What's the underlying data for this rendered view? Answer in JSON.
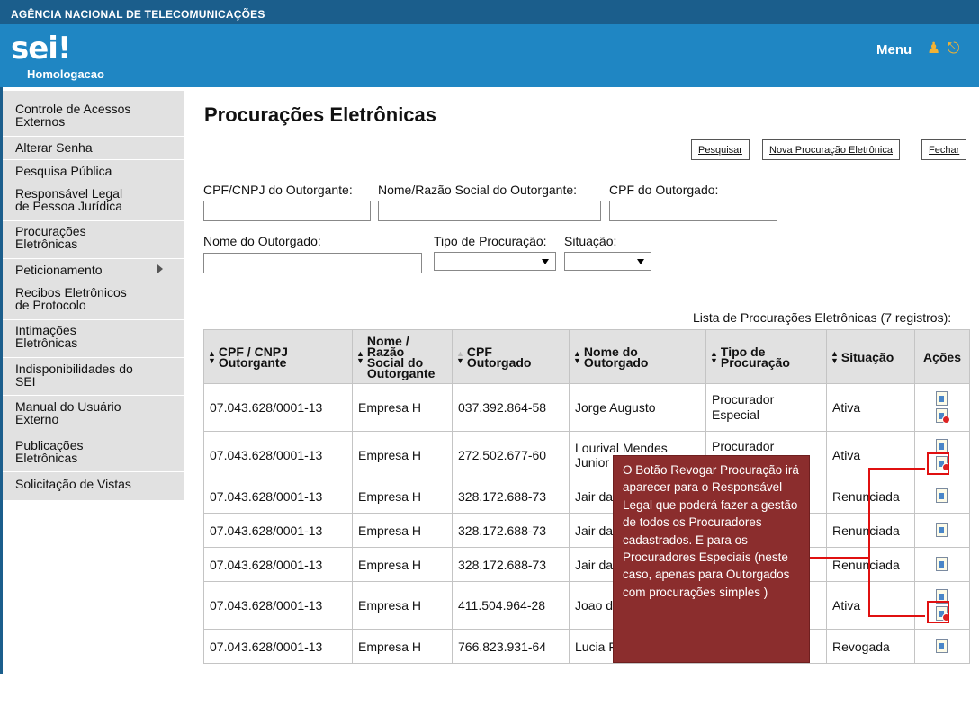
{
  "topbar": {
    "org": "AGÊNCIA NACIONAL DE TELECOMUNICAÇÕES"
  },
  "header": {
    "logo": "sei!",
    "environment": "Homologacao",
    "menu_label": "Menu"
  },
  "sidebar": {
    "items": [
      {
        "label": "Controle de Acessos\nExternos"
      },
      {
        "label": "Alterar Senha"
      },
      {
        "label": "Pesquisa Pública"
      },
      {
        "label": "Responsável Legal\nde Pessoa Jurídica"
      },
      {
        "label": "Procurações\nEletrônicas"
      },
      {
        "label": "Peticionamento"
      },
      {
        "label": "Recibos Eletrônicos\nde Protocolo"
      },
      {
        "label": "Intimações\nEletrônicas"
      },
      {
        "label": "Indisponibilidades do\nSEI"
      },
      {
        "label": "Manual do Usuário\nExterno"
      },
      {
        "label": "Publicações\nEletrônicas"
      },
      {
        "label": "Solicitação de Vistas"
      }
    ]
  },
  "page": {
    "title": "Procurações Eletrônicas",
    "buttons": {
      "search": "Pesquisar",
      "new": "Nova Procuração Eletrônica",
      "close": "Fechar"
    }
  },
  "filters": {
    "cpf_outorgante_label": "CPF/CNPJ do Outorgante:",
    "nome_outorgante_label": "Nome/Razão Social do Outorgante:",
    "cpf_outorgado_label": "CPF do Outorgado:",
    "nome_outorgado_label": "Nome do Outorgado:",
    "tipo_label": "Tipo de Procuração:",
    "situacao_label": "Situação:"
  },
  "table": {
    "caption": "Lista de Procurações Eletrônicas (7 registros):",
    "columns": {
      "c1": "CPF / CNPJ\nOutorgante",
      "c2": "Nome /\nRazão\nSocial do\nOutorgante",
      "c3": "CPF\nOutorgado",
      "c4": "Nome do\nOutorgado",
      "c5": "Tipo de\nProcuração",
      "c6": "Situação",
      "c7": "Ações"
    },
    "rows": [
      {
        "cpf_cnpj": "07.043.628/0001-13",
        "razao": "Empresa H",
        "cpf": "037.392.864-58",
        "nome": "Jorge Augusto",
        "tipo": "Procurador\nEspecial",
        "situacao": "Ativa",
        "revoke": true
      },
      {
        "cpf_cnpj": "07.043.628/0001-13",
        "razao": "Empresa H",
        "cpf": "272.502.677-60",
        "nome": "Lourival Mendes\nJunior",
        "tipo": "Procurador",
        "situacao": "Ativa",
        "revoke": true
      },
      {
        "cpf_cnpj": "07.043.628/0001-13",
        "razao": "Empresa H",
        "cpf": "328.172.688-73",
        "nome": "Jair da",
        "tipo": "",
        "situacao": "Renunciada",
        "revoke": false
      },
      {
        "cpf_cnpj": "07.043.628/0001-13",
        "razao": "Empresa H",
        "cpf": "328.172.688-73",
        "nome": "Jair da",
        "tipo": "",
        "situacao": "Renunciada",
        "revoke": false
      },
      {
        "cpf_cnpj": "07.043.628/0001-13",
        "razao": "Empresa H",
        "cpf": "328.172.688-73",
        "nome": "Jair da",
        "tipo": "",
        "situacao": "Renunciada",
        "revoke": false
      },
      {
        "cpf_cnpj": "07.043.628/0001-13",
        "razao": "Empresa H",
        "cpf": "411.504.964-28",
        "nome": "Joao d",
        "tipo": "",
        "situacao": "Ativa",
        "revoke": true
      },
      {
        "cpf_cnpj": "07.043.628/0001-13",
        "razao": "Empresa H",
        "cpf": "766.823.931-64",
        "nome": "Lucia F",
        "tipo": "",
        "situacao": "Revogada",
        "revoke": false
      }
    ]
  },
  "tooltip": {
    "text": "O Botão Revogar Procuração irá aparecer para o Responsável Legal que poderá fazer a gestão de todos os Procuradores cadastrados. E para os Procuradores Especiais (neste caso, apenas para Outorgados com procurações simples )"
  },
  "colors": {
    "topbar": "#1b5e8c",
    "header": "#1f86c3",
    "sidebar": "#e1e1e1",
    "tooltip": "#8b2d2d",
    "highlight": "#e01010"
  }
}
